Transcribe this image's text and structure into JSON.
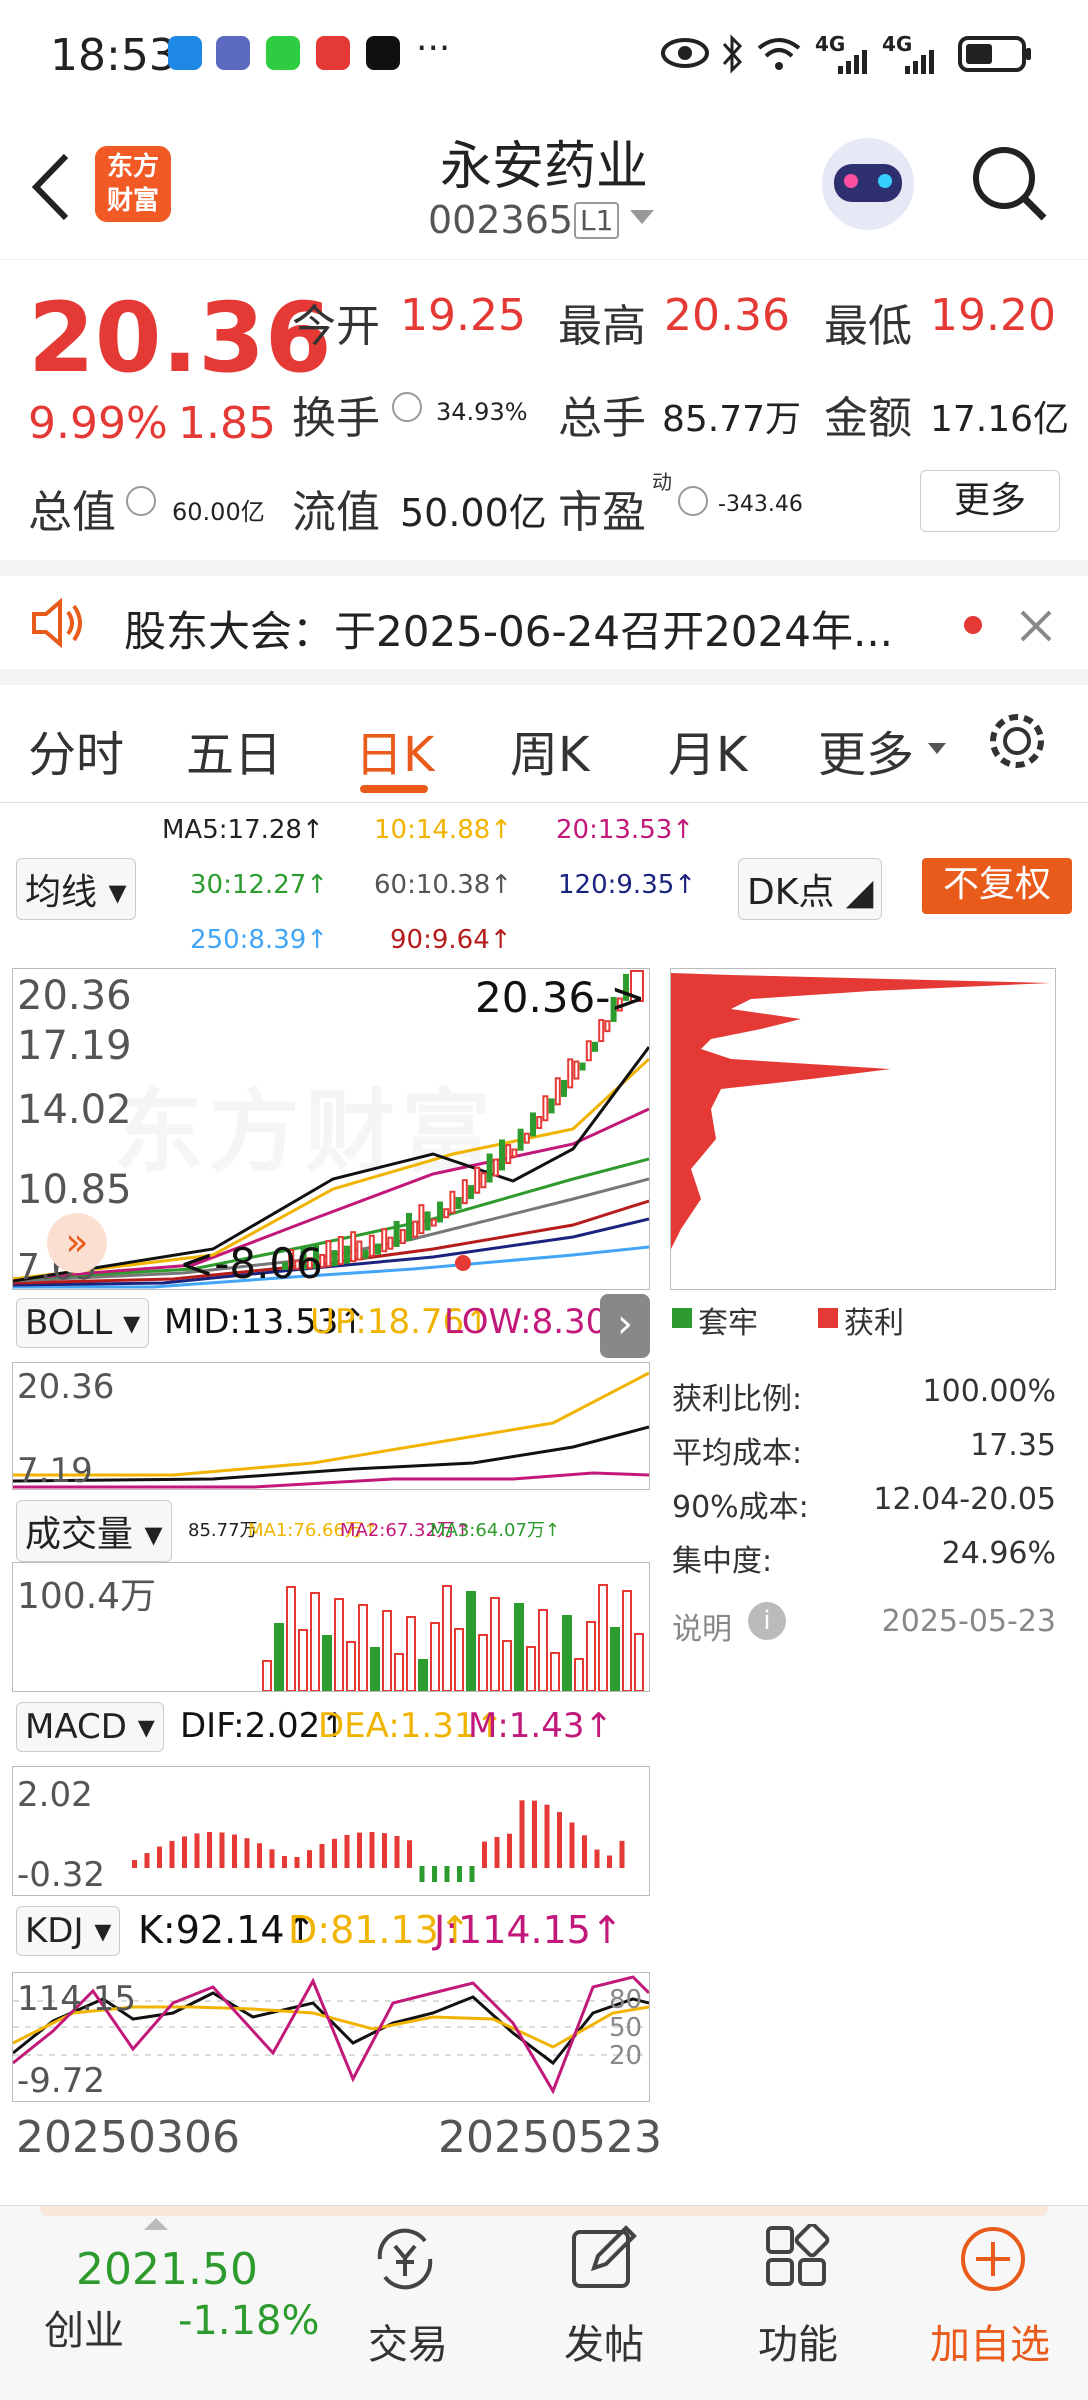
{
  "status_bar": {
    "time": "18:53",
    "more": "···",
    "network1": "4G",
    "network2": "4G"
  },
  "header": {
    "title": "永安药业",
    "code": "002365",
    "level": "L1",
    "logo_line1": "东方",
    "logo_line2": "财富"
  },
  "quote": {
    "price": "20.36",
    "change_pct": "9.99%",
    "change": "1.85",
    "open_label": "今开",
    "open": "19.25",
    "high_label": "最高",
    "high": "20.36",
    "low_label": "最低",
    "low": "19.20",
    "turnover_label": "换手",
    "turnover": "34.93%",
    "volume_label": "总手",
    "volume": "85.77万",
    "amount_label": "金额",
    "amount": "17.16亿",
    "mcap_label": "总值",
    "mcap": "60.00亿",
    "float_label": "流值",
    "float": "50.00亿",
    "pe_label": "市盈",
    "pe_sup": "动",
    "pe": "-343.46",
    "more_btn": "更多"
  },
  "notice": {
    "text": "股东大会：于2025-06-24召开2024年..."
  },
  "tabs": [
    "分时",
    "五日",
    "日K",
    "周K",
    "月K",
    "更多"
  ],
  "ma": {
    "ma5": "MA5:17.28↑",
    "ma10": "10:14.88↑",
    "ma20": "20:13.53↑",
    "ma30": "30:12.27↑",
    "ma60": "60:10.38↑",
    "ma120": "120:9.35↑",
    "ma250": "250:8.39↑",
    "ma90": "90:9.64↑",
    "select": "均线",
    "dk": "DK点",
    "fq": "不复权"
  },
  "kline": {
    "y1": "20.36",
    "y2": "17.19",
    "y3": "14.02",
    "y4": "10.85",
    "y5": "7.69",
    "last": "20.36->",
    "low": "<-8.06",
    "watermark": "东方财富"
  },
  "boll": {
    "select": "BOLL",
    "mid": "MID:13.53↑",
    "up": "UP:18.76↑",
    "low": "LOW:8.30↓",
    "y1": "20.36",
    "y2": "7.19"
  },
  "vol": {
    "select": "成交量",
    "v": "85.77万",
    "ma1": "MA1:76.66万↑",
    "ma2": "MA2:67.32万↑",
    "ma3": "MA3:64.07万↑",
    "y1": "100.4万"
  },
  "macd": {
    "select": "MACD",
    "dif": "DIF:2.02↑",
    "dea": "DEA:1.31↑",
    "m": "M:1.43↑",
    "y1": "2.02",
    "y2": "-0.32"
  },
  "kdj": {
    "select": "KDJ",
    "k": "K:92.14↑",
    "d": "D:81.13↑",
    "j": "J:114.15↑",
    "y1": "114.15",
    "y2": "-9.72",
    "r80": "80",
    "r50": "50",
    "r20": "20"
  },
  "dates": {
    "start": "20250306",
    "end": "20250523"
  },
  "chips": {
    "legend_trapped": "套牢",
    "legend_profit": "获利",
    "ratio_label": "获利比例:",
    "ratio": "100.00%",
    "avg_label": "平均成本:",
    "avg": "17.35",
    "c90_label": "90%成本:",
    "c90": "12.04-20.05",
    "conc_label": "集中度:",
    "conc": "24.96%",
    "note_label": "说明",
    "date": "2025-05-23"
  },
  "bottom_nav": {
    "index_value": "2021.50",
    "index_name": "创业",
    "index_change": "-1.18%",
    "trade": "交易",
    "post": "发帖",
    "func": "功能",
    "add": "加自选"
  },
  "colors": {
    "up": "#e53935",
    "down": "#2e9b2e",
    "accent": "#e85b1b"
  }
}
